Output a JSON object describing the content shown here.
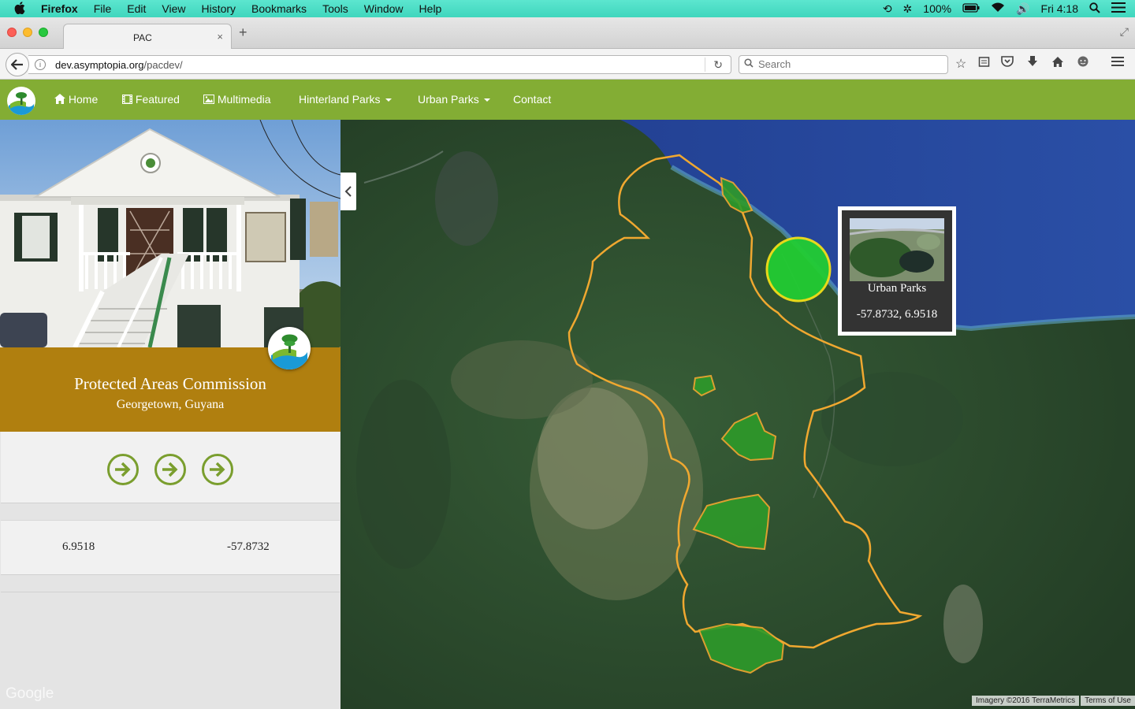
{
  "menubar": {
    "apple": "",
    "app": "Firefox",
    "items": [
      "File",
      "Edit",
      "View",
      "History",
      "Bookmarks",
      "Tools",
      "Window",
      "Help"
    ],
    "battery": "100%",
    "clock": "Fri 4:18"
  },
  "browser": {
    "tab_title": "PAC",
    "tab_close": "×",
    "new_tab": "+",
    "url_host": "dev.asymptopia.org",
    "url_path": "/pacdev/",
    "search_placeholder": "Search"
  },
  "site_nav": {
    "home": "Home",
    "featured": "Featured",
    "multimedia": "Multimedia",
    "hinterland": "Hinterland Parks",
    "urban": "Urban Parks",
    "contact": "Contact"
  },
  "panel": {
    "title": "Protected Areas Commission",
    "subtitle": "Georgetown, Guyana",
    "latitude": "6.9518",
    "longitude": "-57.8732",
    "google": "Google"
  },
  "map": {
    "popup_name": "Urban Parks",
    "popup_coords": "-57.8732, 6.9518",
    "attribution": "Imagery ©2016 TerraMetrics",
    "terms": "Terms of Use",
    "marker_color": "#22cc33",
    "boundary_color": "#f0a830",
    "park_fill": "#2e9a2a"
  }
}
